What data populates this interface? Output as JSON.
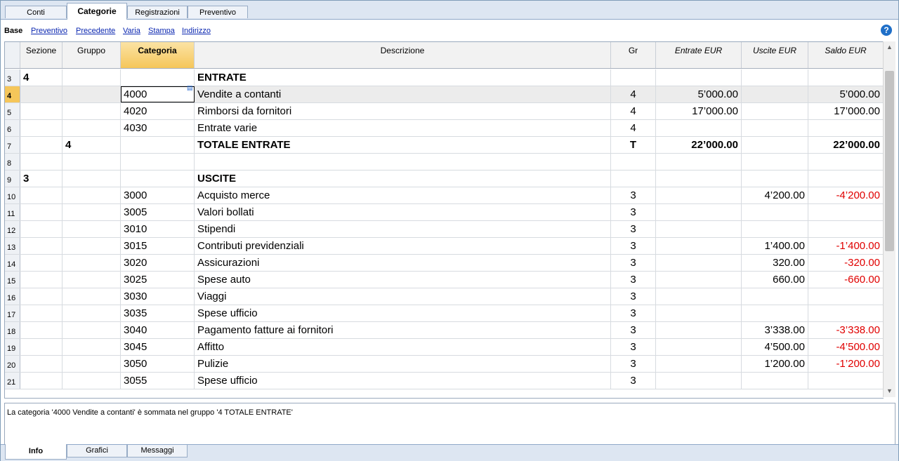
{
  "top_tabs": [
    "Conti",
    "Categorie",
    "Registrazioni",
    "Preventivo"
  ],
  "active_top_tab": 1,
  "subtabs": [
    "Base",
    "Preventivo",
    "Precedente",
    "Varia",
    "Stampa",
    "Indirizzo"
  ],
  "active_subtab": 0,
  "help_icon": "?",
  "columns": {
    "sezione": "Sezione",
    "gruppo": "Gruppo",
    "categoria": "Categoria",
    "descrizione": "Descrizione",
    "gr": "Gr",
    "entrate": "Entrate EUR",
    "uscite": "Uscite EUR",
    "saldo": "Saldo EUR"
  },
  "rows": [
    {
      "n": "3",
      "sezione": "4",
      "gruppo": "",
      "categoria": "",
      "descrizione": "ENTRATE",
      "gr": "",
      "entrate": "",
      "uscite": "",
      "saldo": "",
      "bold": true
    },
    {
      "n": "4",
      "sezione": "",
      "gruppo": "",
      "categoria": "4000",
      "descrizione": "Vendite a contanti",
      "gr": "4",
      "entrate": "5’000.00",
      "uscite": "",
      "saldo": "5’000.00",
      "current": true
    },
    {
      "n": "5",
      "sezione": "",
      "gruppo": "",
      "categoria": "4020",
      "descrizione": "Rimborsi da fornitori",
      "gr": "4",
      "entrate": "17’000.00",
      "uscite": "",
      "saldo": "17’000.00"
    },
    {
      "n": "6",
      "sezione": "",
      "gruppo": "",
      "categoria": "4030",
      "descrizione": "Entrate varie",
      "gr": "4",
      "entrate": "",
      "uscite": "",
      "saldo": ""
    },
    {
      "n": "7",
      "sezione": "",
      "gruppo": "4",
      "categoria": "",
      "descrizione": "TOTALE ENTRATE",
      "gr": "T",
      "entrate": "22’000.00",
      "uscite": "",
      "saldo": "22’000.00",
      "bold": true
    },
    {
      "n": "8",
      "sezione": "",
      "gruppo": "",
      "categoria": "",
      "descrizione": "",
      "gr": "",
      "entrate": "",
      "uscite": "",
      "saldo": ""
    },
    {
      "n": "9",
      "sezione": "3",
      "gruppo": "",
      "categoria": "",
      "descrizione": "USCITE",
      "gr": "",
      "entrate": "",
      "uscite": "",
      "saldo": "",
      "bold": true
    },
    {
      "n": "10",
      "sezione": "",
      "gruppo": "",
      "categoria": "3000",
      "descrizione": "Acquisto merce",
      "gr": "3",
      "entrate": "",
      "uscite": "4’200.00",
      "saldo": "-4’200.00"
    },
    {
      "n": "11",
      "sezione": "",
      "gruppo": "",
      "categoria": "3005",
      "descrizione": "Valori bollati",
      "gr": "3",
      "entrate": "",
      "uscite": "",
      "saldo": ""
    },
    {
      "n": "12",
      "sezione": "",
      "gruppo": "",
      "categoria": "3010",
      "descrizione": "Stipendi",
      "gr": "3",
      "entrate": "",
      "uscite": "",
      "saldo": ""
    },
    {
      "n": "13",
      "sezione": "",
      "gruppo": "",
      "categoria": "3015",
      "descrizione": "Contributi previdenziali",
      "gr": "3",
      "entrate": "",
      "uscite": "1’400.00",
      "saldo": "-1’400.00"
    },
    {
      "n": "14",
      "sezione": "",
      "gruppo": "",
      "categoria": "3020",
      "descrizione": "Assicurazioni",
      "gr": "3",
      "entrate": "",
      "uscite": "320.00",
      "saldo": "-320.00"
    },
    {
      "n": "15",
      "sezione": "",
      "gruppo": "",
      "categoria": "3025",
      "descrizione": "Spese auto",
      "gr": "3",
      "entrate": "",
      "uscite": "660.00",
      "saldo": "-660.00"
    },
    {
      "n": "16",
      "sezione": "",
      "gruppo": "",
      "categoria": "3030",
      "descrizione": "Viaggi",
      "gr": "3",
      "entrate": "",
      "uscite": "",
      "saldo": ""
    },
    {
      "n": "17",
      "sezione": "",
      "gruppo": "",
      "categoria": "3035",
      "descrizione": "Spese ufficio",
      "gr": "3",
      "entrate": "",
      "uscite": "",
      "saldo": ""
    },
    {
      "n": "18",
      "sezione": "",
      "gruppo": "",
      "categoria": "3040",
      "descrizione": "Pagamento fatture ai fornitori",
      "gr": "3",
      "entrate": "",
      "uscite": "3’338.00",
      "saldo": "-3’338.00"
    },
    {
      "n": "19",
      "sezione": "",
      "gruppo": "",
      "categoria": "3045",
      "descrizione": "Affitto",
      "gr": "3",
      "entrate": "",
      "uscite": "4’500.00",
      "saldo": "-4’500.00"
    },
    {
      "n": "20",
      "sezione": "",
      "gruppo": "",
      "categoria": "3050",
      "descrizione": "Pulizie",
      "gr": "3",
      "entrate": "",
      "uscite": "1’200.00",
      "saldo": "-1’200.00"
    },
    {
      "n": "21",
      "sezione": "",
      "gruppo": "",
      "categoria": "3055",
      "descrizione": "Spese ufficio",
      "gr": "3",
      "entrate": "",
      "uscite": "",
      "saldo": ""
    }
  ],
  "info_text": "La categoria '4000 Vendite a contanti' è sommata nel gruppo '4 TOTALE ENTRATE'",
  "bottom_tabs": [
    "Info",
    "Grafici",
    "Messaggi"
  ],
  "active_bottom_tab": 0,
  "colors": {
    "negative": "#e00000",
    "selected_header": "#f5c65a",
    "link": "#0a26b0"
  }
}
